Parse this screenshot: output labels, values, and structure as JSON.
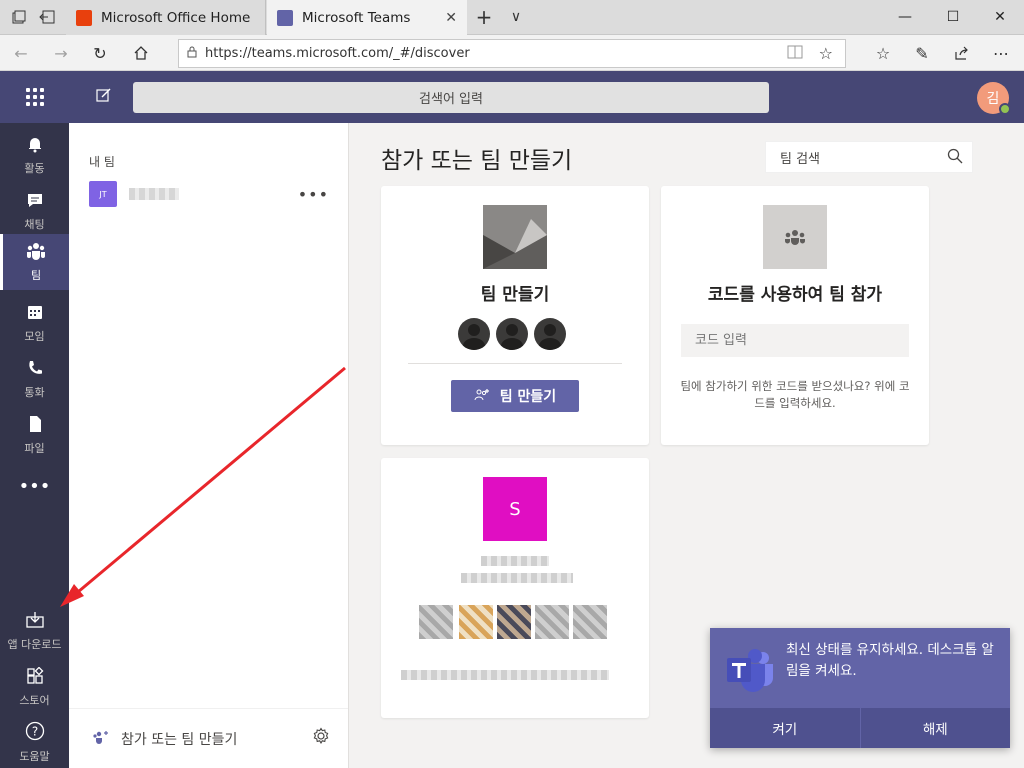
{
  "browser": {
    "tabs": [
      {
        "title": "Microsoft Office Home",
        "favicon_color": "#e8400d",
        "active": false
      },
      {
        "title": "Microsoft Teams",
        "favicon_color": "#6264a7",
        "active": true
      }
    ],
    "new_tab_label": "+",
    "tab_menu_label": "∨",
    "url": "https://teams.microsoft.com/_#/discover",
    "controls": {
      "minimize": "—",
      "maximize": "☐",
      "close": "✕"
    }
  },
  "teams_header": {
    "search_placeholder": "검색어 입력",
    "avatar_initial": "김",
    "avatar_color": "#f29b7b",
    "presence": "available"
  },
  "rail": {
    "items": [
      {
        "label": "활동",
        "icon": "bell-icon"
      },
      {
        "label": "채팅",
        "icon": "chat-icon"
      },
      {
        "label": "팀",
        "icon": "teams-icon",
        "active": true
      },
      {
        "label": "모임",
        "icon": "calendar-icon"
      },
      {
        "label": "통화",
        "icon": "phone-icon"
      },
      {
        "label": "파일",
        "icon": "file-icon"
      },
      {
        "label": "•••",
        "icon": "more-icon"
      }
    ],
    "bottom_items": [
      {
        "label": "앱 다운로드",
        "icon": "download-icon"
      },
      {
        "label": "스토어",
        "icon": "store-icon"
      },
      {
        "label": "도움말",
        "icon": "help-icon"
      }
    ]
  },
  "team_list": {
    "heading": "내 팀",
    "teams": [
      {
        "initials": "JT",
        "name_blurred": true
      }
    ],
    "footer_label": "참가 또는 팀 만들기"
  },
  "main": {
    "title": "참가 또는 팀 만들기",
    "search_placeholder": "팀 검색",
    "create_card": {
      "title": "팀 만들기",
      "button_label": "팀 만들기"
    },
    "join_card": {
      "title": "코드를 사용하여 팀 참가",
      "code_placeholder": "코드 입력",
      "help_text": "팀에 참가하기 위한 코드를 받으셨나요? 위에 코드를 입력하세요."
    },
    "team_card": {
      "initial": "S",
      "color": "#e00ec2"
    }
  },
  "toast": {
    "message": "최신 상태를 유지하세요. 데스크톱 알림을 켜세요.",
    "primary_label": "켜기",
    "secondary_label": "해제"
  },
  "colors": {
    "brand": "#6264a7",
    "header": "#464775",
    "rail": "#33344a",
    "annotation_arrow": "#e8262b"
  }
}
